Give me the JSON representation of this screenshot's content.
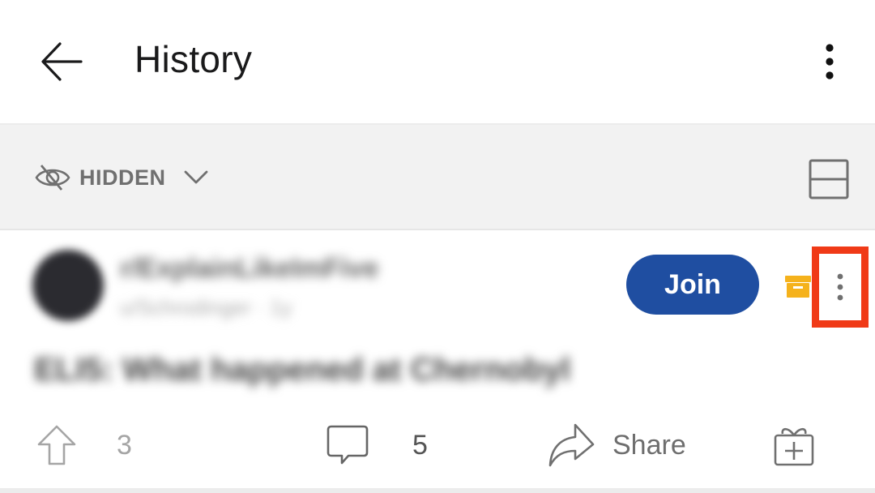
{
  "app_bar": {
    "title": "History",
    "back_icon": "arrow-left-icon",
    "overflow_icon": "more-vertical-icon"
  },
  "filter_bar": {
    "filter_label": "HIDDEN",
    "filter_icon": "eye-off-icon",
    "dropdown_icon": "chevron-down-icon",
    "layout_icon": "card-layout-icon"
  },
  "post": {
    "community": "r/ExplainLikeImFive",
    "meta": "u/Schrodinger · 1y",
    "join_label": "Join",
    "archive_icon": "archive-icon",
    "more_icon": "more-vertical-icon",
    "title": "ELI5: What happened at Chernobyl",
    "actions": {
      "upvotes": "3",
      "comments": "5",
      "share_label": "Share",
      "award_icon": "gift-plus-icon"
    }
  },
  "colors": {
    "join_button": "#1f4ea1",
    "highlight_box": "#f03a17",
    "archive_icon": "#f5b21c",
    "filter_bar_bg": "#f2f2f2"
  }
}
